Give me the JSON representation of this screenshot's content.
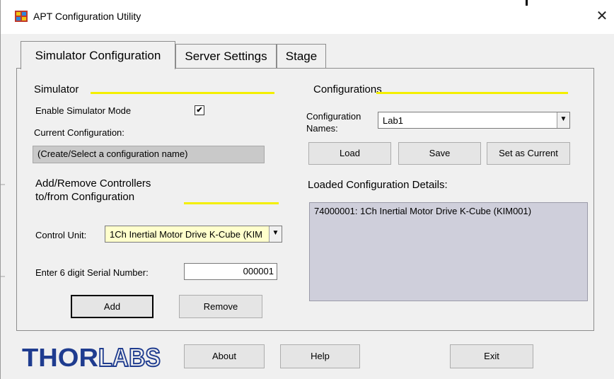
{
  "window": {
    "title": "APT Configuration Utility",
    "close_glyph": "✕"
  },
  "tabs": [
    {
      "label": "Simulator Configuration"
    },
    {
      "label": "Server Settings"
    },
    {
      "label": "Stage"
    }
  ],
  "simulator": {
    "header": "Simulator",
    "enable_label": "Enable Simulator Mode",
    "enable_checked": "✔",
    "current_config_label": "Current Configuration:",
    "current_config_value": "(Create/Select a configuration name)"
  },
  "add_remove": {
    "header_line1": "Add/Remove Controllers",
    "header_line2": "to/from Configuration",
    "control_unit_label": "Control Unit:",
    "control_unit_value": "1Ch Inertial Motor Drive K-Cube (KIM",
    "serial_label": "Enter 6 digit Serial Number:",
    "serial_value": "000001",
    "add_label": "Add",
    "remove_label": "Remove"
  },
  "configurations": {
    "header": "Configurations",
    "names_label_line1": "Configuration",
    "names_label_line2": "Names:",
    "names_value": "Lab1",
    "load_label": "Load",
    "save_label": "Save",
    "set_current_label": "Set as Current",
    "details_label": "Loaded Configuration Details:",
    "details_value": "74000001: 1Ch Inertial Motor Drive K-Cube (KIM001)"
  },
  "footer": {
    "logo_text": "THORLABS",
    "about_label": "About",
    "help_label": "Help",
    "exit_label": "Exit"
  },
  "colors": {
    "accent_yellow": "#f4ef00",
    "logo_blue": "#1f3c8f",
    "combo_highlight": "#ffffcc"
  }
}
